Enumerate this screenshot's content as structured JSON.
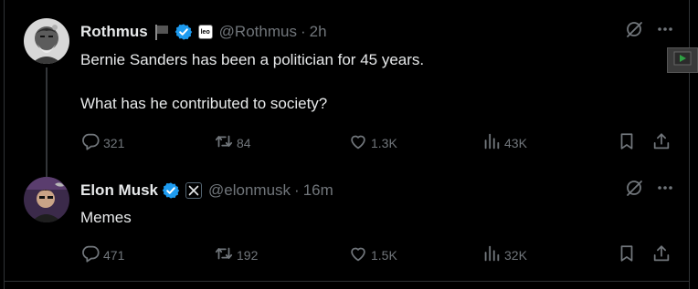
{
  "colors": {
    "accent": "#1d9bf0",
    "muted": "#71767b",
    "text": "#e7e9ea",
    "background": "#000000",
    "play": "#2ea043"
  },
  "tweets": [
    {
      "name": "Rothmus",
      "handle": "@Rothmus",
      "separator": "·",
      "time": "2h",
      "lines": [
        "Bernie Sanders has been a politician for 45 years.",
        "What has he contributed to society?"
      ],
      "affiliate_badge": "leo",
      "stats": {
        "replies": "321",
        "reposts": "84",
        "likes": "1.3K",
        "views": "43K"
      }
    },
    {
      "name": "Elon Musk",
      "handle": "@elonmusk",
      "separator": "·",
      "time": "16m",
      "lines": [
        "Memes"
      ],
      "stats": {
        "replies": "471",
        "reposts": "192",
        "likes": "1.5K",
        "views": "32K"
      }
    }
  ],
  "icons": [
    "flag-icon",
    "verified-icon",
    "grok-icon",
    "more-icon",
    "reply-icon",
    "repost-icon",
    "like-icon",
    "views-icon",
    "bookmark-icon",
    "share-icon",
    "x-logo-icon",
    "play-icon"
  ]
}
